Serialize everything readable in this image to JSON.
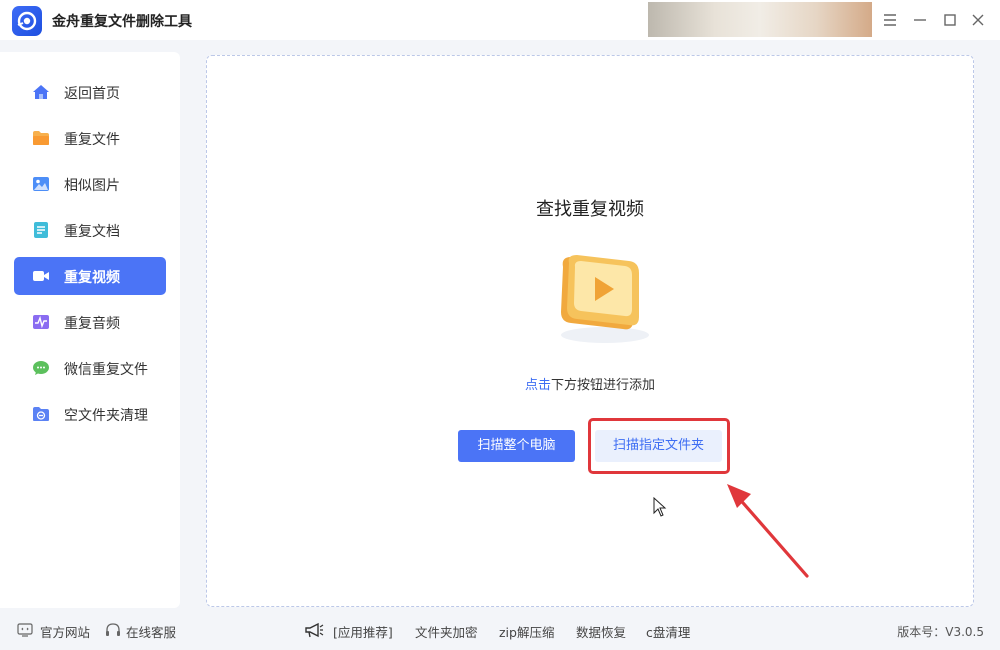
{
  "app": {
    "title": "金舟重复文件删除工具"
  },
  "window": {
    "menu_icon": "menu-icon",
    "min_icon": "minimize-icon",
    "max_icon": "maximize-icon",
    "close_icon": "close-icon"
  },
  "sidebar": {
    "items": [
      {
        "label": "返回首页",
        "icon": "home-icon",
        "active": false
      },
      {
        "label": "重复文件",
        "icon": "folder-icon",
        "active": false
      },
      {
        "label": "相似图片",
        "icon": "image-icon",
        "active": false
      },
      {
        "label": "重复文档",
        "icon": "document-icon",
        "active": false
      },
      {
        "label": "重复视频",
        "icon": "video-icon",
        "active": true
      },
      {
        "label": "重复音频",
        "icon": "audio-icon",
        "active": false
      },
      {
        "label": "微信重复文件",
        "icon": "wechat-icon",
        "active": false
      },
      {
        "label": "空文件夹清理",
        "icon": "empty-folder-icon",
        "active": false
      }
    ]
  },
  "main": {
    "heading": "查找重复视频",
    "hint_highlight": "点击",
    "hint_rest": "下方按钮进行添加",
    "scan_pc_label": "扫描整个电脑",
    "scan_folder_label": "扫描指定文件夹"
  },
  "footer": {
    "official_site": "官方网站",
    "online_service": "在线客服",
    "recommend": "[应用推荐]",
    "links": [
      "文件夹加密",
      "zip解压缩",
      "数据恢复",
      "c盘清理"
    ],
    "version": "版本号：V3.0.5"
  },
  "colors": {
    "accent": "#4b74f6",
    "highlight_red": "#e0373b",
    "link_blue": "#3d6df3"
  }
}
